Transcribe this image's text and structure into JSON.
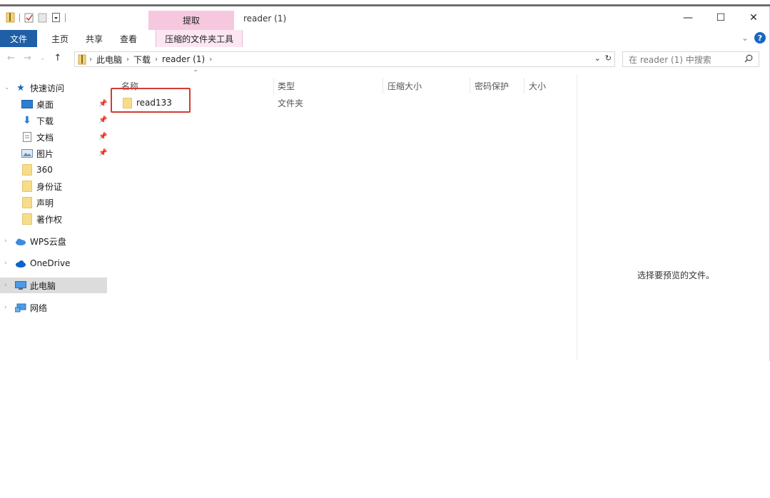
{
  "title_bar": {
    "context_tab_header": "提取",
    "window_title": "reader (1)",
    "controls": [
      "—",
      "☐",
      "✕"
    ]
  },
  "ribbon": {
    "tabs": [
      "文件",
      "主页",
      "共享",
      "查看",
      "压缩的文件夹工具"
    ],
    "help_glyph": "?",
    "collapse_glyph": "⌄"
  },
  "address": {
    "crumbs": [
      "此电脑",
      "下载",
      "reader (1)"
    ],
    "search_placeholder": "在 reader (1) 中搜索"
  },
  "nav": {
    "quick_access": "快速访问",
    "pinned": [
      "桌面",
      "下载",
      "文档",
      "图片"
    ],
    "folders": [
      "360",
      "身份证",
      "声明",
      "著作权"
    ],
    "wps_cloud": "WPS云盘",
    "onedrive": "OneDrive",
    "this_pc": "此电脑",
    "network": "网络"
  },
  "columns": {
    "name": "名称",
    "type": "类型",
    "compressed_size": "压缩大小",
    "password": "密码保护",
    "size": "大小"
  },
  "files": [
    {
      "name": "read133",
      "type": "文件夹"
    }
  ],
  "preview": {
    "message": "选择要预览的文件。"
  },
  "colors": {
    "file_tab": "#1f5fa8",
    "context_tab": "#f6c8e0",
    "highlight_box": "#d23c33",
    "folder": "#f7dd8a"
  }
}
